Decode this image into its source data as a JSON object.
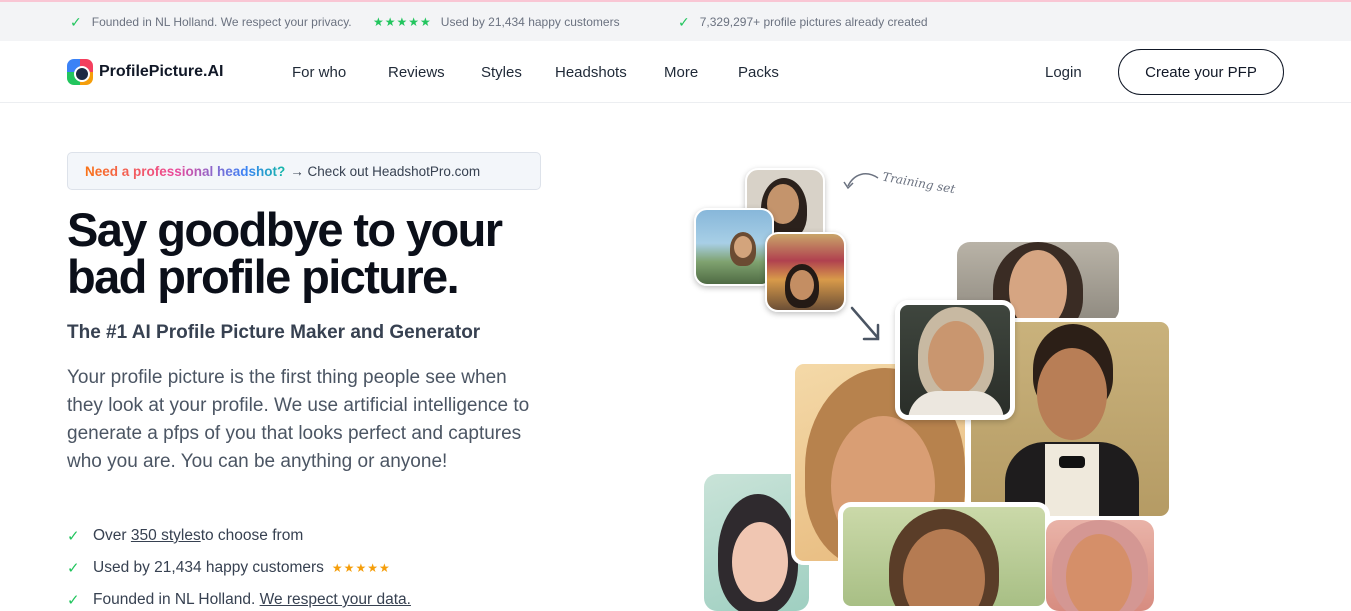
{
  "topbar": {
    "items": [
      {
        "text": "Founded in NL Holland. We respect your privacy."
      },
      {
        "stars": "★★★★★",
        "text": "Used by 21,434 happy customers"
      },
      {
        "text": "7,329,297+ profile pictures already created"
      }
    ]
  },
  "nav": {
    "logo_text": "ProfilePicture.AI",
    "links": [
      "For who",
      "Reviews",
      "Styles",
      "Headshots",
      "More",
      "Packs"
    ],
    "login": "Login",
    "cta": "Create your PFP"
  },
  "hero": {
    "promo_highlight": "Need a professional headshot?",
    "promo_rest": "→ Check out HeadshotPro.com",
    "headline_line1": "Say goodbye to your",
    "headline_line2": "bad profile picture.",
    "subtitle": "The #1 AI Profile Picture Maker and Generator",
    "description": "Your profile picture is the first thing people see when they look at your profile. We use artificial intelligence to generate a pfps of you that looks perfect and captures who you are. You can be anything or anyone!",
    "bullets": {
      "b1_pre": "Over ",
      "b1_link": "350 styles ",
      "b1_post": "to choose from",
      "b2_text": "Used by 21,434 happy customers",
      "b2_stars": "★★★★★",
      "b3_pre": "Founded in NL Holland. ",
      "b3_link": "We respect your data."
    },
    "training_label": "Training set"
  },
  "icons": {
    "check": "check-icon",
    "star": "star-icon",
    "arrow": "arrow-icon"
  },
  "colors": {
    "accent_green": "#22c55e",
    "star_gold": "#f59e0b",
    "text_dark": "#0b0f19"
  }
}
